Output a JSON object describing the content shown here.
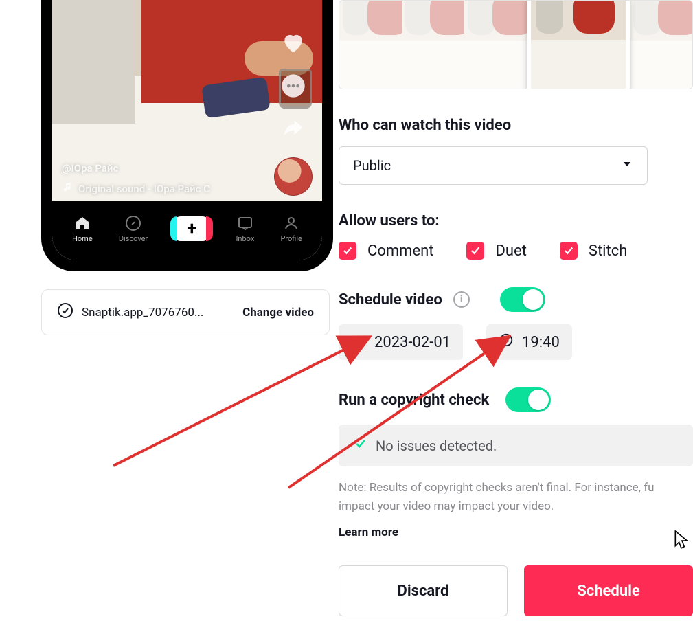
{
  "preview": {
    "username": "@IОра Райс",
    "sound_label": "Original sound - IОра Райс С"
  },
  "phone_nav": {
    "home": "Home",
    "discover": "Discover",
    "inbox": "Inbox",
    "profile": "Profile"
  },
  "file": {
    "name": "Snaptik.app_7076760...",
    "change_label": "Change video"
  },
  "visibility": {
    "title": "Who can watch this video",
    "selected": "Public"
  },
  "allow": {
    "title": "Allow users to:",
    "comment": "Comment",
    "duet": "Duet",
    "stitch": "Stitch"
  },
  "schedule": {
    "title": "Schedule video",
    "date": "2023-02-01",
    "time": "19:40"
  },
  "copyright": {
    "title": "Run a copyright check",
    "status": "No issues detected.",
    "note": "Note: Results of copyright checks aren't final. For instance, fu impact your video may impact your video.",
    "learn_more": "Learn more"
  },
  "actions": {
    "discard": "Discard",
    "submit": "Schedule"
  }
}
